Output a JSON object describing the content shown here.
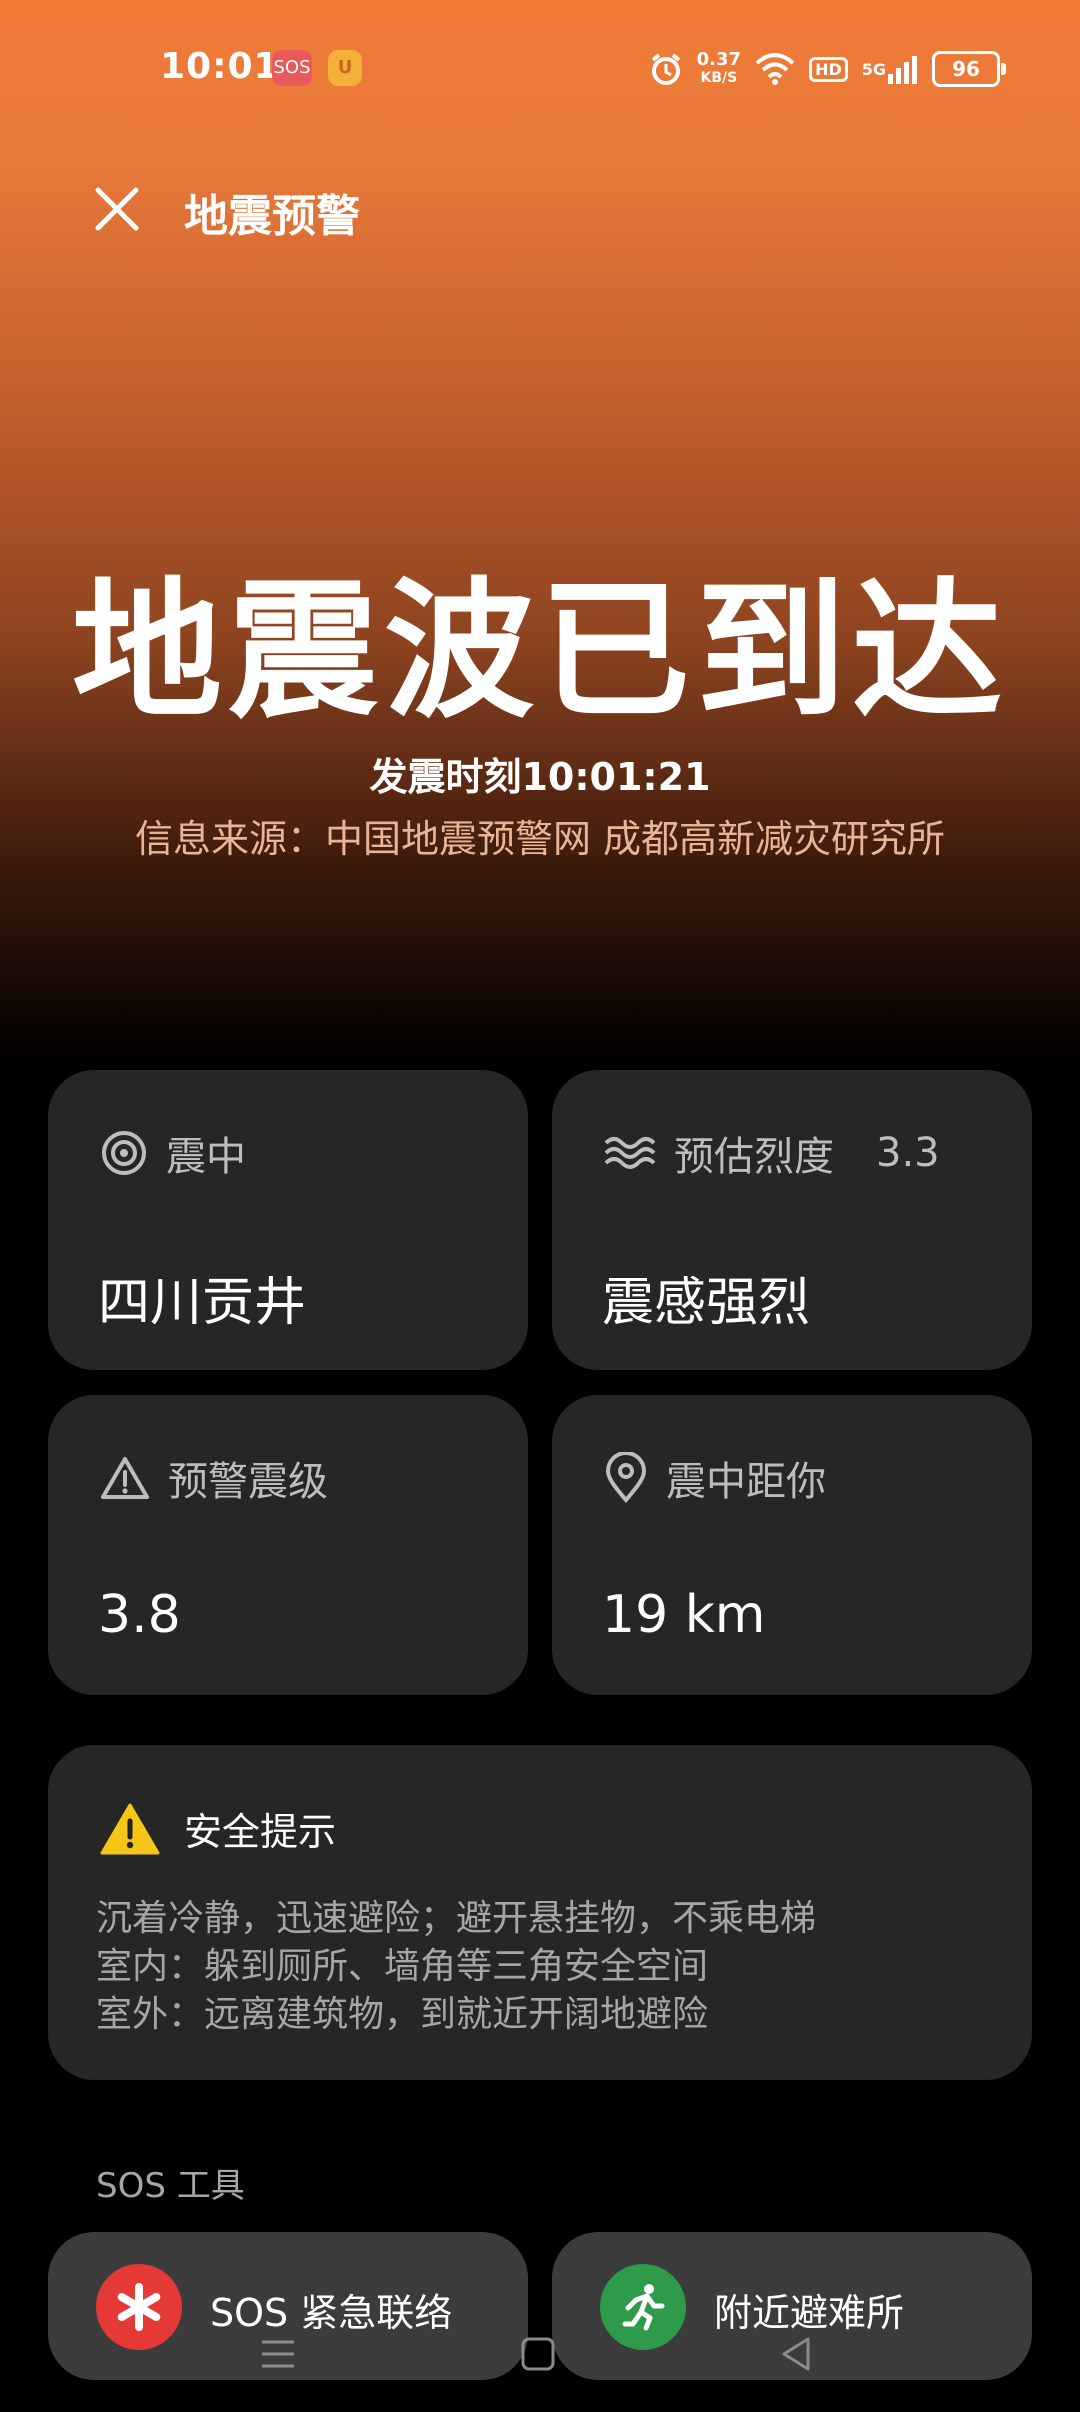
{
  "status_bar": {
    "time": "10:01",
    "sos_badge": "SOS",
    "speed_value": "0.37",
    "speed_unit": "KB/S",
    "hd": "HD",
    "network": "5G",
    "battery": "96"
  },
  "header": {
    "title": "地震预警"
  },
  "alert": {
    "headline": "地震波已到达",
    "time_text": "发震时刻10:01:21",
    "source_text": "信息来源：中国地震预警网 成都高新减灾研究所"
  },
  "cards": {
    "epicenter": {
      "label": "震中",
      "value": "四川贡井"
    },
    "intensity": {
      "label": "预估烈度",
      "extra": "3.3",
      "value": "震感强烈"
    },
    "magnitude": {
      "label": "预警震级",
      "value": "3.8"
    },
    "distance": {
      "label": "震中距你",
      "value": "19 km"
    }
  },
  "safety": {
    "title": "安全提示",
    "lines": [
      "沉着冷静，迅速避险；避开悬挂物，不乘电梯",
      "室内：躲到厕所、墙角等三角安全空间",
      "室外：远离建筑物，到就近开阔地避险"
    ]
  },
  "sos_tools": {
    "header": "SOS 工具",
    "items": [
      {
        "label": "SOS 紧急联络"
      },
      {
        "label": "附近避难所"
      }
    ]
  },
  "colors": {
    "accent_orange": "#f07a36",
    "card_bg": "#262626",
    "sos_red": "#e53935",
    "shelter_green": "#2e9b4b",
    "warning_yellow": "#f5c518"
  }
}
